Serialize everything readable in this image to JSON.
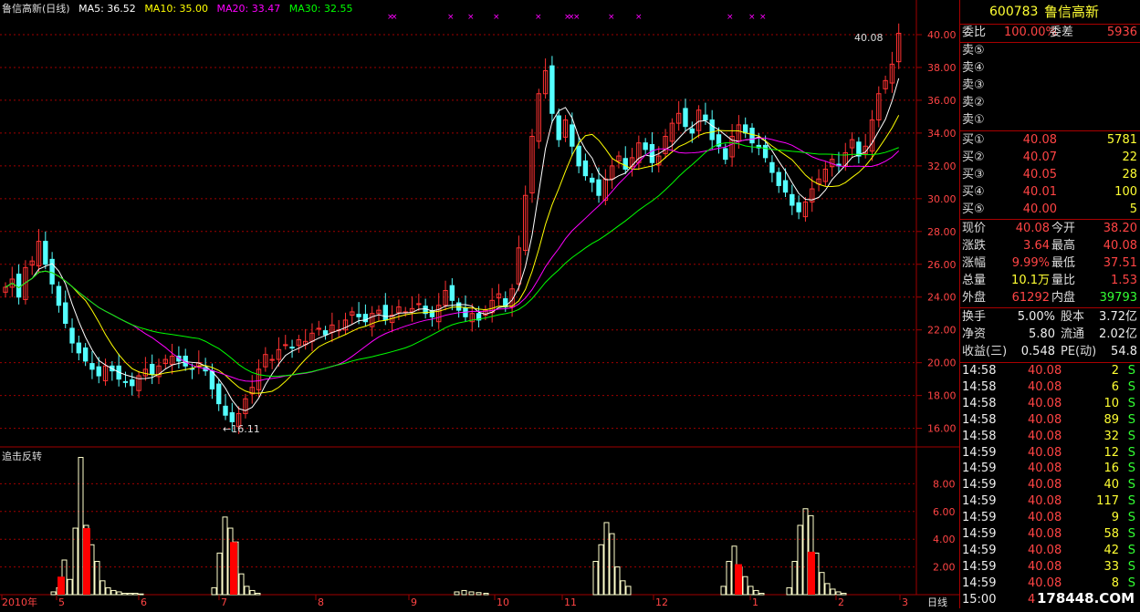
{
  "header": {
    "name": "鲁信高新(日线)",
    "ma5": "MA5: 36.52",
    "ma10": "MA10: 35.00",
    "ma20": "MA20: 33.47",
    "ma30": "MA30: 32.55"
  },
  "colors": {
    "ma5": "#ffffff",
    "ma10": "#ffff00",
    "ma20": "#ff00ff",
    "ma30": "#00ff00",
    "up": "#ff3232",
    "down": "#54ffff",
    "grid": "#a00000"
  },
  "price_axis": {
    "labels": [
      "40.00",
      "38.00",
      "36.00",
      "34.00",
      "32.00",
      "30.00",
      "28.00",
      "26.00",
      "24.00",
      "22.00",
      "20.00",
      "18.00",
      "16.00"
    ]
  },
  "vol_axis": {
    "labels": [
      "8.00",
      "6.00",
      "4.00",
      "2.00"
    ]
  },
  "annotations": {
    "high": "40.08",
    "low": "←16.11"
  },
  "indicator_title": "追击反转",
  "x_axis": {
    "labels": [
      "2010年",
      "5",
      "6",
      "7",
      "8",
      "9",
      "10",
      "11",
      "12",
      "1",
      "2",
      "3"
    ],
    "period": "日线"
  },
  "chart_data": {
    "type": "candlestick",
    "title": "鲁信高新(日线)",
    "ylim": [
      15.2,
      41.0
    ],
    "series": [
      {
        "name": "MA5",
        "last": 36.52
      },
      {
        "name": "MA10",
        "last": 35.0
      },
      {
        "name": "MA20",
        "last": 33.47
      },
      {
        "name": "MA30",
        "last": 32.55
      }
    ],
    "close": [
      24.6,
      25.1,
      24.0,
      25.8,
      26.2,
      27.4,
      26.0,
      24.8,
      23.5,
      22.4,
      21.2,
      20.6,
      20.1,
      19.6,
      19.2,
      19.8,
      19.5,
      19.0,
      18.8,
      18.6,
      19.2,
      19.6,
      19.3,
      19.8,
      20.2,
      20.4,
      20.1,
      19.8,
      19.6,
      20.0,
      19.5,
      18.4,
      17.5,
      16.8,
      16.4,
      16.9,
      17.8,
      18.5,
      19.6,
      20.5,
      20.2,
      20.8,
      21.1,
      20.9,
      21.4,
      21.3,
      21.8,
      22.1,
      21.7,
      22.3,
      22.0,
      22.6,
      23.1,
      22.8,
      22.5,
      23.0,
      23.2,
      22.6,
      22.9,
      23.4,
      23.1,
      23.3,
      23.6,
      23.0,
      22.8,
      23.5,
      24.4,
      23.8,
      23.2,
      22.8,
      23.0,
      22.6,
      23.2,
      23.8,
      24.2,
      23.4,
      24.5,
      27.0,
      30.2,
      33.8,
      36.4,
      37.8,
      35.2,
      33.6,
      34.8,
      33.2,
      32.0,
      31.4,
      31.0,
      30.2,
      31.2,
      32.0,
      32.6,
      31.8,
      32.5,
      33.4,
      33.0,
      32.2,
      32.6,
      33.8,
      34.6,
      35.2,
      34.4,
      34.0,
      35.4,
      34.8,
      33.6,
      33.2,
      32.4,
      33.8,
      34.5,
      34.0,
      33.4,
      33.1,
      32.5,
      31.6,
      30.8,
      30.4,
      29.6,
      29.2,
      29.8,
      30.6,
      31.2,
      31.8,
      32.4,
      32.0,
      32.8,
      33.6,
      32.6,
      33.2,
      34.8,
      36.4,
      37.2,
      38.2,
      40.08
    ],
    "volume_ylim": [
      0,
      10
    ],
    "volume_white_heights": [
      2.5,
      4.8,
      9.9,
      3.0,
      1.8,
      0.6,
      6.0,
      7.5,
      2.2,
      1.2,
      0.4,
      0.5,
      0.8,
      5.2,
      2.8,
      1.5,
      0.6,
      0.4,
      5.5,
      4.0,
      2.4,
      1.3,
      0.4,
      4.0,
      5.8,
      4.8,
      2.6,
      1.4,
      0.6
    ],
    "volume_red_heights": [
      1.3,
      4.8,
      3.8,
      2.2,
      3.1
    ]
  },
  "panel": {
    "code": "600783",
    "name": "鲁信高新",
    "weibi_label": "委比",
    "weibi": "100.00%",
    "weicha_label": "委差",
    "weicha": "5936",
    "sells": [
      {
        "label": "卖⑤",
        "price": "",
        "vol": ""
      },
      {
        "label": "卖④",
        "price": "",
        "vol": ""
      },
      {
        "label": "卖③",
        "price": "",
        "vol": ""
      },
      {
        "label": "卖②",
        "price": "",
        "vol": ""
      },
      {
        "label": "卖①",
        "price": "",
        "vol": ""
      }
    ],
    "buys": [
      {
        "label": "买①",
        "price": "40.08",
        "vol": "5781"
      },
      {
        "label": "买②",
        "price": "40.07",
        "vol": "22"
      },
      {
        "label": "买③",
        "price": "40.05",
        "vol": "28"
      },
      {
        "label": "买④",
        "price": "40.01",
        "vol": "100"
      },
      {
        "label": "买⑤",
        "price": "40.00",
        "vol": "5"
      }
    ],
    "quote": [
      {
        "l1": "现价",
        "v1": "40.08",
        "c1": "red",
        "l2": "今开",
        "v2": "38.20",
        "c2": "red"
      },
      {
        "l1": "涨跌",
        "v1": "3.64",
        "c1": "red",
        "l2": "最高",
        "v2": "40.08",
        "c2": "red"
      },
      {
        "l1": "涨幅",
        "v1": "9.99%",
        "c1": "red",
        "l2": "最低",
        "v2": "37.51",
        "c2": "red"
      },
      {
        "l1": "总量",
        "v1": "10.1万",
        "c1": "yellow",
        "l2": "量比",
        "v2": "1.53",
        "c2": "red"
      },
      {
        "l1": "外盘",
        "v1": "61292",
        "c1": "red",
        "l2": "内盘",
        "v2": "39793",
        "c2": "green"
      }
    ],
    "fund": [
      {
        "l1": "换手",
        "v1": "5.00%",
        "l2": "股本",
        "v2": "3.72亿"
      },
      {
        "l1": "净资",
        "v1": "5.80",
        "l2": "流通",
        "v2": "2.02亿"
      },
      {
        "l1": "收益(三)",
        "v1": "0.548",
        "l2": "PE(动)",
        "v2": "54.8"
      }
    ],
    "ticks": [
      {
        "t": "14:58",
        "p": "40.08",
        "v": "2",
        "s": "S"
      },
      {
        "t": "14:58",
        "p": "40.08",
        "v": "6",
        "s": "S"
      },
      {
        "t": "14:58",
        "p": "40.08",
        "v": "10",
        "s": "S"
      },
      {
        "t": "14:58",
        "p": "40.08",
        "v": "89",
        "s": "S"
      },
      {
        "t": "14:58",
        "p": "40.08",
        "v": "32",
        "s": "S"
      },
      {
        "t": "14:59",
        "p": "40.08",
        "v": "12",
        "s": "S"
      },
      {
        "t": "14:59",
        "p": "40.08",
        "v": "16",
        "s": "S"
      },
      {
        "t": "14:59",
        "p": "40.08",
        "v": "40",
        "s": "S"
      },
      {
        "t": "14:59",
        "p": "40.08",
        "v": "117",
        "s": "S"
      },
      {
        "t": "14:59",
        "p": "40.08",
        "v": "9",
        "s": "S"
      },
      {
        "t": "14:59",
        "p": "40.08",
        "v": "58",
        "s": "S"
      },
      {
        "t": "14:59",
        "p": "40.08",
        "v": "42",
        "s": "S"
      },
      {
        "t": "14:59",
        "p": "40.08",
        "v": "33",
        "s": "S"
      },
      {
        "t": "14:59",
        "p": "40.08",
        "v": "8",
        "s": "S"
      },
      {
        "t": "15:00",
        "p": "40.08",
        "v": "",
        "s": ""
      }
    ]
  },
  "watermark": "178448.COM"
}
